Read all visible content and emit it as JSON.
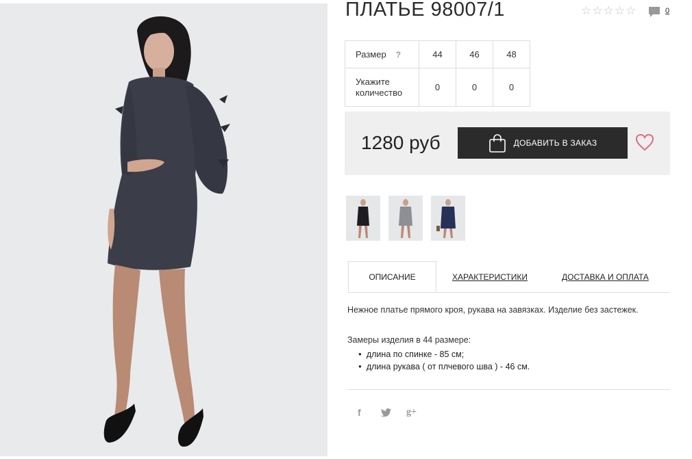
{
  "product": {
    "title": "ПЛАТЬЕ 98007/1",
    "rating_stars": 5,
    "rating_value": 0,
    "comment_count": "0"
  },
  "sizes": {
    "size_label": "Размер",
    "help_symbol": "?",
    "values": [
      "44",
      "46",
      "48"
    ],
    "quantity_label": "Укажите количество",
    "quantities": [
      "0",
      "0",
      "0"
    ]
  },
  "purchase": {
    "price": "1280 руб",
    "add_button_label": "ДОБАВИТЬ В ЗАКАЗ"
  },
  "thumbnails": [
    {
      "name": "thumbnail-black-dress"
    },
    {
      "name": "thumbnail-grey-dress"
    },
    {
      "name": "thumbnail-navy-dress"
    }
  ],
  "tabs": [
    {
      "label": "ОПИСАНИЕ",
      "active": true
    },
    {
      "label": "ХАРАКТЕРИСТИКИ",
      "active": false
    },
    {
      "label": "ДОСТАВКА И ОПЛАТА",
      "active": false
    }
  ],
  "description": {
    "text": "Нежное платье прямого кроя, рукава на завязках. Изделие без застежек.",
    "measurements_title": "Замеры изделия в 44 размере:",
    "measurements": [
      "длина по спинке - 85 см;",
      "длина рукава ( от плчевого шва ) - 46 см."
    ]
  },
  "social": {
    "facebook": "f",
    "twitter": "twitter-icon",
    "google_plus": "g+"
  },
  "colors": {
    "button_bg": "#2b2b2b",
    "buybox_bg": "#efefef",
    "heart": "#e06b80",
    "star": "#c6c6c6"
  }
}
